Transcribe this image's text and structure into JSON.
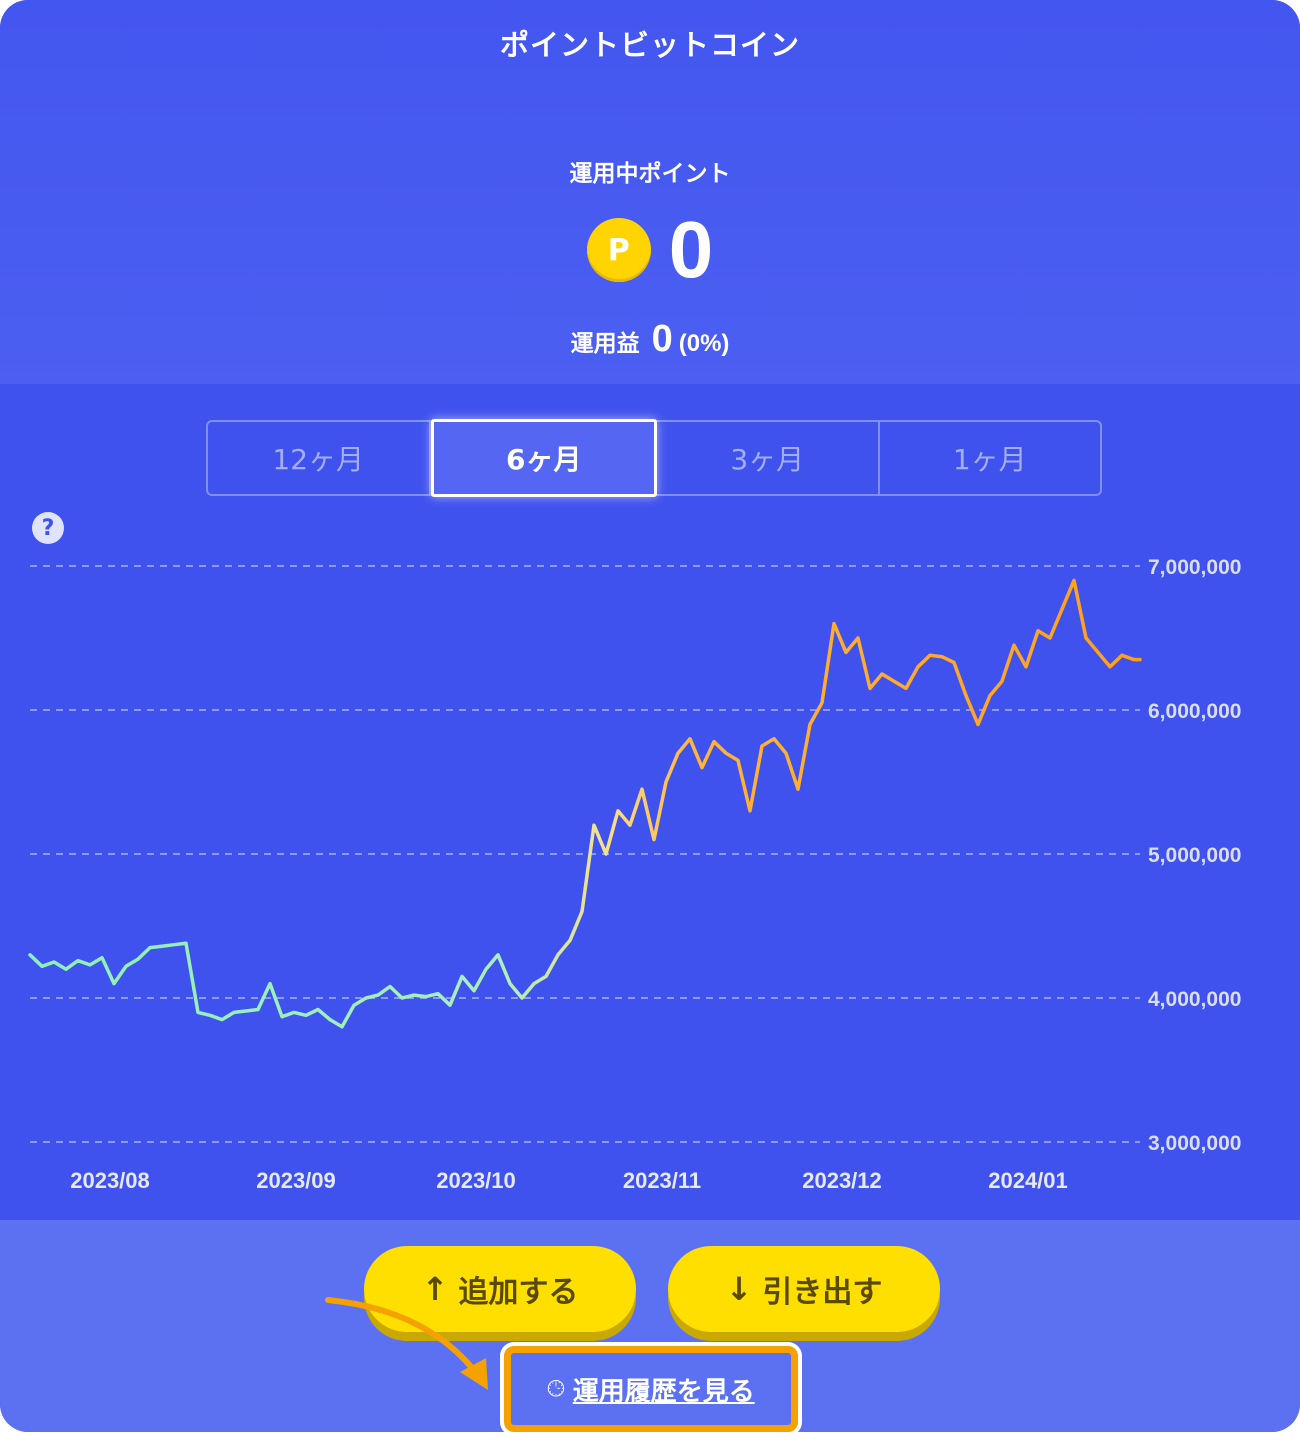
{
  "app_title": "ポイントビットコイン",
  "holding": {
    "label": "運用中ポイント",
    "coin_symbol": "P",
    "value": "0"
  },
  "profit": {
    "label": "運用益",
    "value": "0",
    "percent": "(0%)"
  },
  "tabs": [
    {
      "label": "12ヶ月",
      "active": false
    },
    {
      "label": "6ヶ月",
      "active": true
    },
    {
      "label": "3ヶ月",
      "active": false
    },
    {
      "label": "1ヶ月",
      "active": false
    }
  ],
  "help_icon": "question-circle-icon",
  "actions": {
    "add_label": "追加する",
    "add_icon": "arrow-up-icon",
    "withdraw_label": "引き出す",
    "withdraw_icon": "arrow-down-icon",
    "history_label": "運用履歴を見る",
    "history_icon": "clock-history-icon"
  },
  "colors": {
    "background": "#4356ef",
    "chart_background": "#3f52ee",
    "button": "#ffdf00",
    "highlight": "#f5a200",
    "line_start": "#8ef0b8",
    "line_end": "#ff9f1c"
  },
  "chart_data": {
    "type": "line",
    "title": "",
    "xlabel": "",
    "ylabel": "",
    "ylim": [
      3000000,
      7000000
    ],
    "y_ticks": [
      "7,000,000",
      "6,000,000",
      "5,000,000",
      "4,000,000",
      "3,000,000"
    ],
    "y_tick_values": [
      7000000,
      6000000,
      5000000,
      4000000,
      3000000
    ],
    "x_ticks": [
      "2023/08",
      "2023/09",
      "2023/10",
      "2023/11",
      "2023/12",
      "2024/01"
    ],
    "x_tick_dates": [
      "2023-08-01",
      "2023-09-01",
      "2023-10-01",
      "2023-11-01",
      "2023-12-01",
      "2024-01-01"
    ],
    "x_range": [
      "2023-07-20",
      "2024-01-21"
    ],
    "grid": true,
    "series": [
      {
        "x": [
          "2023-07-20",
          "2023-07-22",
          "2023-07-24",
          "2023-07-26",
          "2023-07-28",
          "2023-07-30",
          "2023-08-01",
          "2023-08-03",
          "2023-08-05",
          "2023-08-07",
          "2023-08-09",
          "2023-08-11",
          "2023-08-13",
          "2023-08-15",
          "2023-08-17",
          "2023-08-19",
          "2023-08-21",
          "2023-08-23",
          "2023-08-25",
          "2023-08-27",
          "2023-08-29",
          "2023-08-31",
          "2023-09-02",
          "2023-09-04",
          "2023-09-06",
          "2023-09-08",
          "2023-09-10",
          "2023-09-12",
          "2023-09-14",
          "2023-09-16",
          "2023-09-18",
          "2023-09-20",
          "2023-09-22",
          "2023-09-24",
          "2023-09-26",
          "2023-09-28",
          "2023-09-30",
          "2023-10-02",
          "2023-10-04",
          "2023-10-06",
          "2023-10-08",
          "2023-10-10",
          "2023-10-12",
          "2023-10-14",
          "2023-10-16",
          "2023-10-18",
          "2023-10-20",
          "2023-10-22",
          "2023-10-24",
          "2023-10-26",
          "2023-10-28",
          "2023-10-30",
          "2023-11-01",
          "2023-11-03",
          "2023-11-05",
          "2023-11-07",
          "2023-11-09",
          "2023-11-11",
          "2023-11-13",
          "2023-11-15",
          "2023-11-17",
          "2023-11-19",
          "2023-11-21",
          "2023-11-23",
          "2023-11-25",
          "2023-11-27",
          "2023-11-29",
          "2023-12-01",
          "2023-12-03",
          "2023-12-05",
          "2023-12-07",
          "2023-12-09",
          "2023-12-11",
          "2023-12-13",
          "2023-12-15",
          "2023-12-17",
          "2023-12-19",
          "2023-12-21",
          "2023-12-23",
          "2023-12-25",
          "2023-12-27",
          "2023-12-29",
          "2023-12-31",
          "2024-01-02",
          "2024-01-04",
          "2024-01-06",
          "2024-01-08",
          "2024-01-10",
          "2024-01-12",
          "2024-01-14",
          "2024-01-16",
          "2024-01-18",
          "2024-01-20",
          "2024-01-21"
        ],
        "y": [
          4300000,
          4220000,
          4250000,
          4200000,
          4260000,
          4230000,
          4280000,
          4100000,
          4220000,
          4270000,
          4350000,
          4360000,
          4370000,
          4380000,
          3900000,
          3880000,
          3850000,
          3900000,
          3910000,
          3920000,
          4100000,
          3870000,
          3900000,
          3880000,
          3920000,
          3850000,
          3800000,
          3950000,
          4000000,
          4020000,
          4080000,
          4000000,
          4020000,
          4010000,
          4030000,
          3950000,
          4150000,
          4050000,
          4200000,
          4300000,
          4100000,
          4000000,
          4100000,
          4150000,
          4300000,
          4400000,
          4600000,
          5200000,
          5000000,
          5300000,
          5200000,
          5450000,
          5100000,
          5500000,
          5700000,
          5800000,
          5600000,
          5780000,
          5700000,
          5650000,
          5300000,
          5750000,
          5800000,
          5700000,
          5450000,
          5900000,
          6050000,
          6600000,
          6400000,
          6500000,
          6150000,
          6250000,
          6200000,
          6150000,
          6300000,
          6380000,
          6370000,
          6330000,
          6100000,
          5900000,
          6100000,
          6200000,
          6450000,
          6300000,
          6550000,
          6500000,
          6700000,
          6900000,
          6500000,
          6400000,
          6300000,
          6380000,
          6350000,
          6350000
        ]
      }
    ]
  }
}
